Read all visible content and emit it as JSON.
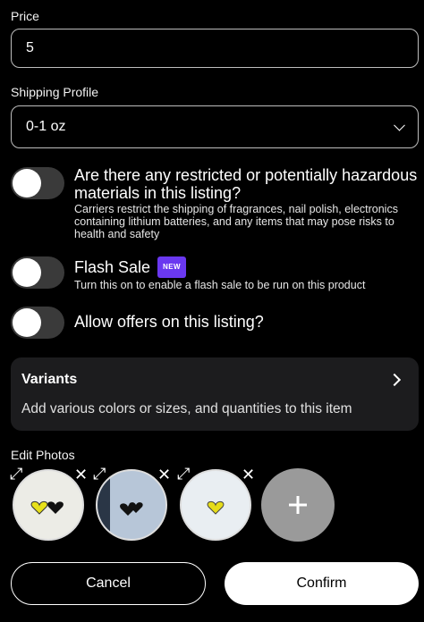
{
  "price": {
    "label": "Price",
    "value": "5"
  },
  "shipping": {
    "label": "Shipping Profile",
    "value": "0-1 oz"
  },
  "options": [
    {
      "title": "Are there any restricted or potentially hazardous materials in this listing?",
      "description": "Carriers restrict the shipping of fragrances, nail polish, electronics containing lithium batteries, and any items that may pose risks to health and safety",
      "enabled": false
    },
    {
      "title": "Flash Sale",
      "badge": "NEW",
      "description": "Turn this on to enable a flash sale to be run on this product",
      "enabled": false
    },
    {
      "title": "Allow offers on this listing?",
      "enabled": false
    }
  ],
  "variants": {
    "title": "Variants",
    "description": "Add various colors or sizes, and quantities to this item"
  },
  "photos": {
    "label": "Edit Photos",
    "items": [
      {
        "name": "photo-1",
        "background": "#ecece6",
        "hearts": [
          "#e7e01a",
          "#111111"
        ]
      },
      {
        "name": "photo-2",
        "background": "#b7c6d8",
        "hearts": [
          "#111111",
          "#111111"
        ]
      },
      {
        "name": "photo-3",
        "background": "#e9eef2",
        "hearts": [
          "#e6dc1a"
        ]
      }
    ],
    "add_icon": "plus-icon",
    "expand_icon": "expand-icon",
    "remove_icon": "close-icon"
  },
  "actions": {
    "cancel": "Cancel",
    "confirm": "Confirm"
  }
}
